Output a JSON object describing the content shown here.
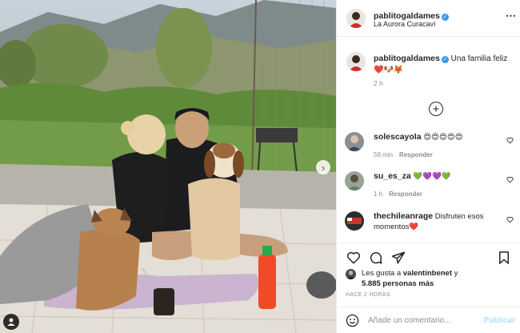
{
  "post": {
    "author": "pablitogaldames",
    "location": "La Aurora Curacaví",
    "caption": "Una familia feliz",
    "caption_emojis": "❤️🐶🦊",
    "caption_time": "2 h"
  },
  "comments": [
    {
      "user": "solescayola",
      "text": "😍😍😍😍😍",
      "time": "58 min",
      "reply": "Responder"
    },
    {
      "user": "su_es_za",
      "text": "💚💜💜💚",
      "time": "1 h",
      "reply": "Responder"
    },
    {
      "user": "thechileanrage",
      "text": "Disfruten esos momentos",
      "emoji": "❤️"
    }
  ],
  "likes": {
    "prefix": "Les gusta a",
    "first_user": "valentinbenet",
    "connector": "y",
    "count": "5.885 personas más"
  },
  "posted_ago": "HACE 2 HORAS",
  "comment_box": {
    "placeholder": "Añade un comentario...",
    "publish": "Publicar"
  },
  "colors": {
    "verified": "#3897f0",
    "publish_disabled": "#b2dffc",
    "muted": "#8e8e8e"
  }
}
